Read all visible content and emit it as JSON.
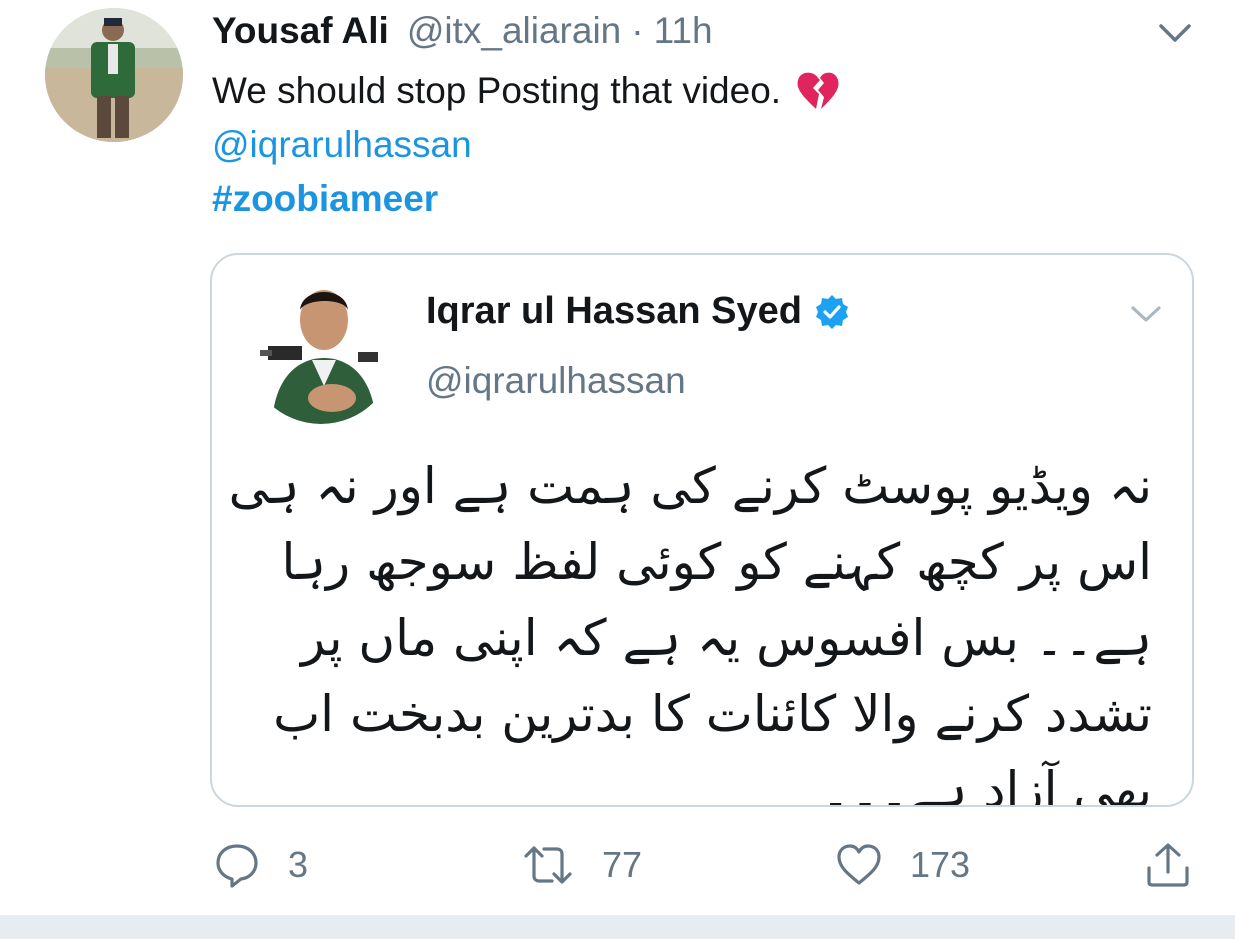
{
  "tweet": {
    "author_name": "Yousaf Ali",
    "author_handle": "@itx_aliarain",
    "separator": "·",
    "time": "11h",
    "text": "We should stop Posting that video.",
    "emoji": "broken-heart-icon",
    "mention": "@iqrarulhassan",
    "hashtag": "#zoobiameer"
  },
  "quoted": {
    "author_name": "Iqrar ul Hassan Syed",
    "author_handle": "@iqrarulhassan",
    "urdu_lines": [
      "نہ ویڈیو پوسٹ کرنے کی ہمت ہے اور نہ ہی",
      "اس پر کچھ کہنے کو کوئی لفظ سوجھ رہا",
      "ہے۔۔  بس افسوس یہ ہے کہ اپنی ماں پر",
      "تشدد کرنے والا کائنات کا بدترین بدبخت اب",
      "بھی آزاد ہے۔۔۔"
    ]
  },
  "actions": {
    "reply_count": "3",
    "retweet_count": "77",
    "like_count": "173"
  },
  "colors": {
    "link": "#1b95e0",
    "secondary": "#657786",
    "border": "#ccd6dd",
    "verified": "#1da1f2",
    "broken_heart": "#e0245e"
  }
}
